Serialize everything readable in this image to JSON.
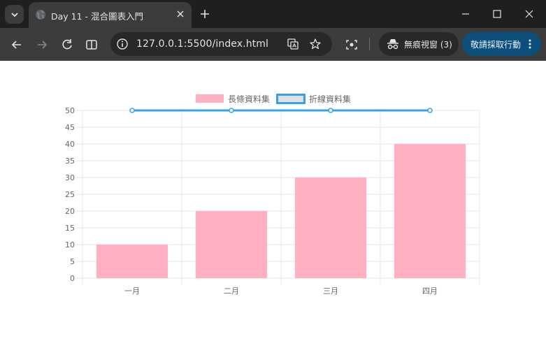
{
  "browser": {
    "tab_title": "Day 11 - 混合圖表入門",
    "url": "127.0.0.1:5500/index.html",
    "incognito_label": "無痕視窗 (3)",
    "sync_button_label": "敬請採取行動"
  },
  "colors": {
    "bar_fill": "#ffb1c1",
    "line_stroke": "#36a2eb",
    "line_legend_fill": "#e0e0e0",
    "grid": "#e5e5e5",
    "text": "#666666"
  },
  "chart_data": {
    "type": "bar",
    "categories": [
      "一月",
      "二月",
      "三月",
      "四月"
    ],
    "series": [
      {
        "name": "長條資料集",
        "type": "bar",
        "values": [
          10,
          20,
          30,
          40
        ]
      },
      {
        "name": "折線資料集",
        "type": "line",
        "values": [
          50,
          50,
          50,
          50
        ]
      }
    ],
    "ylim": [
      0,
      50
    ],
    "yticks": [
      0,
      5,
      10,
      15,
      20,
      25,
      30,
      35,
      40,
      45,
      50
    ],
    "grid": true,
    "legend": "top-center",
    "title": "",
    "xlabel": "",
    "ylabel": ""
  }
}
